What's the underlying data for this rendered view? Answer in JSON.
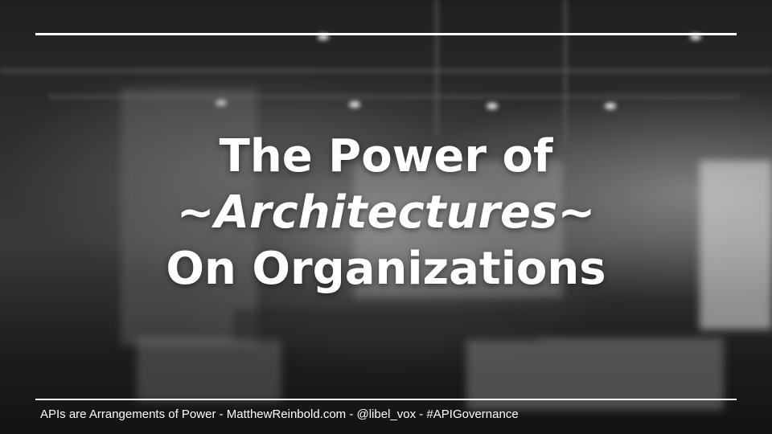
{
  "slide": {
    "title_line_1": "The Power of",
    "title_line_2": "~Architectures~",
    "title_line_3": "On Organizations",
    "footer_text": "APIs are Arrangements of Power - MatthewReinbold.com - @libel_vox - #APIGovernance"
  },
  "colors": {
    "text": "#ffffff",
    "rule": "#ffffff",
    "background_tone": "grayscale"
  }
}
